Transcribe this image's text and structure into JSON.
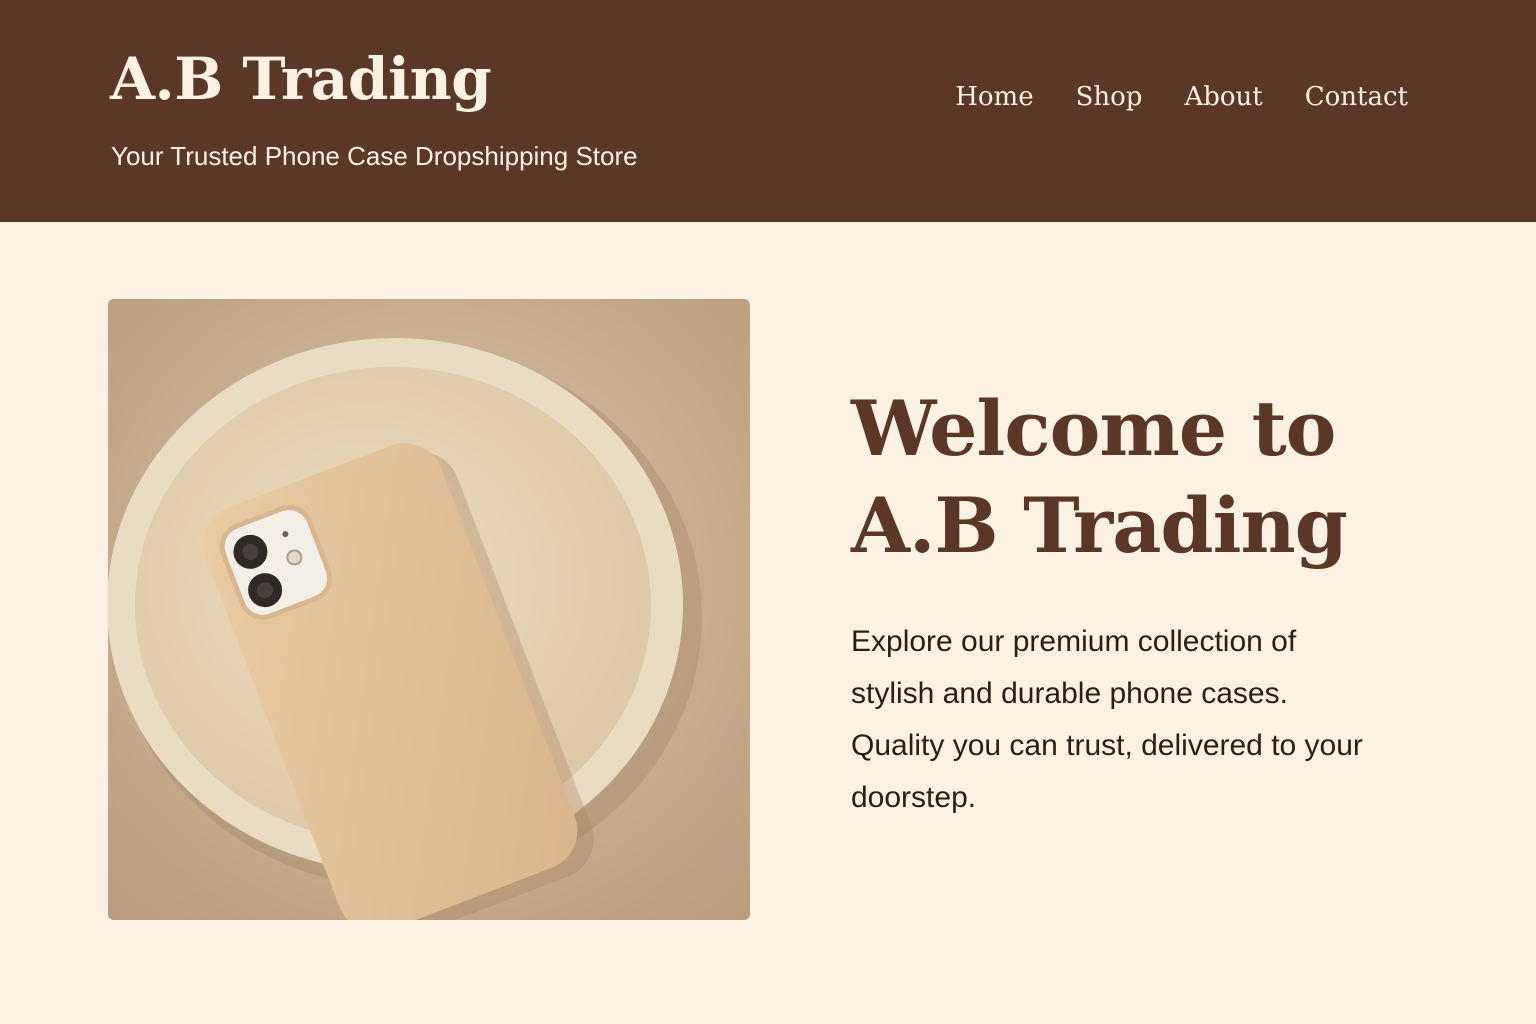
{
  "header": {
    "brand": "A.B Trading",
    "tagline": "Your Trusted Phone Case Dropshipping Store",
    "nav": [
      {
        "label": "Home"
      },
      {
        "label": "Shop"
      },
      {
        "label": "About"
      },
      {
        "label": "Contact"
      }
    ]
  },
  "hero": {
    "heading_line1": "Welcome to",
    "heading_line2": "A.B Trading",
    "body": "Explore our premium collection of stylish and durable phone cases. Quality you can trust, delivered to your doorstep.",
    "image_icon": "phone-case-product-photo"
  },
  "colors": {
    "header_bg": "#5b3726",
    "page_bg": "#fdf2e1",
    "heading": "#5b3726",
    "body_text": "#2d1d15"
  }
}
